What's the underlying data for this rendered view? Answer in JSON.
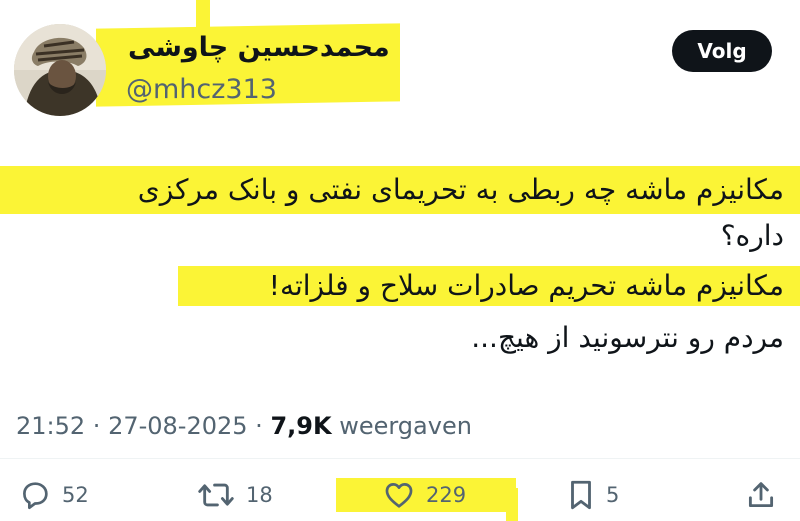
{
  "author": {
    "display_name": "محمدحسین چاوشی",
    "handle": "@mhcz313"
  },
  "follow_button": {
    "label": "Volg"
  },
  "tweet": {
    "lines": [
      "مکانیزم ماشه چه ربطی به تحریمای نفتی و بانک مرکزی",
      "داره؟",
      "مکانیزم ماشه تحریم صادرات سلاح و فلزاته!",
      "مردم رو نترسونید از هیچ..."
    ]
  },
  "meta": {
    "time": "21:52",
    "separator": " · ",
    "date": "27-08-2025",
    "views": "7,9K",
    "views_label": " weergaven"
  },
  "actions": {
    "replies": "52",
    "reposts": "18",
    "likes": "229",
    "bookmarks": "5"
  },
  "colors": {
    "highlight": "#fbf436",
    "text": "#0f1419",
    "secondary": "#536471"
  }
}
